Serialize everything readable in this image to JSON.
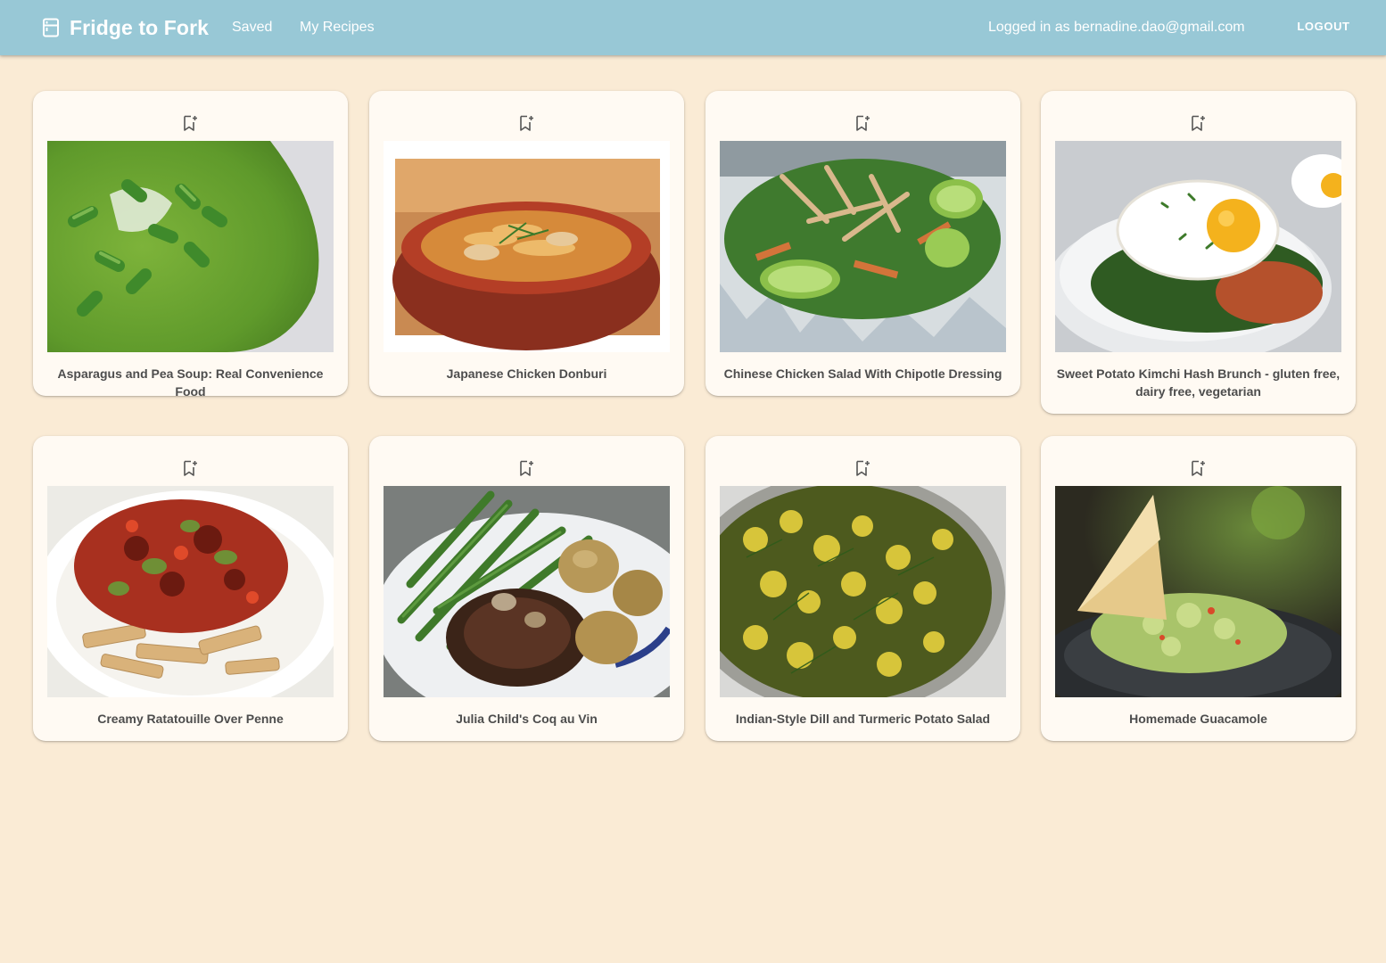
{
  "app": {
    "title": "Fridge to Fork",
    "brand_icon": "fridge-icon"
  },
  "nav": {
    "saved_label": "Saved",
    "my_recipes_label": "My Recipes"
  },
  "user": {
    "logged_in_text": "Logged in as bernadine.dao@gmail.com",
    "logout_label": "LOGOUT"
  },
  "colors": {
    "header": "#98c8d6",
    "page_background": "#faebd5",
    "card_background": "#fffaf3"
  },
  "recipes": [
    {
      "title": "Asparagus and Pea Soup: Real Convenience Food",
      "bookmark_icon": "bookmark-add-icon"
    },
    {
      "title": "Japanese Chicken Donburi",
      "bookmark_icon": "bookmark-add-icon"
    },
    {
      "title": "Chinese Chicken Salad With Chipotle Dressing",
      "bookmark_icon": "bookmark-add-icon"
    },
    {
      "title": "Sweet Potato Kimchi Hash Brunch - gluten free, dairy free, vegetarian",
      "bookmark_icon": "bookmark-add-icon"
    },
    {
      "title": "Creamy Ratatouille Over Penne",
      "bookmark_icon": "bookmark-add-icon"
    },
    {
      "title": "Julia Child's Coq au Vin",
      "bookmark_icon": "bookmark-add-icon"
    },
    {
      "title": "Indian-Style Dill and Turmeric Potato Salad",
      "bookmark_icon": "bookmark-add-icon"
    },
    {
      "title": "Homemade Guacamole",
      "bookmark_icon": "bookmark-add-icon"
    }
  ]
}
